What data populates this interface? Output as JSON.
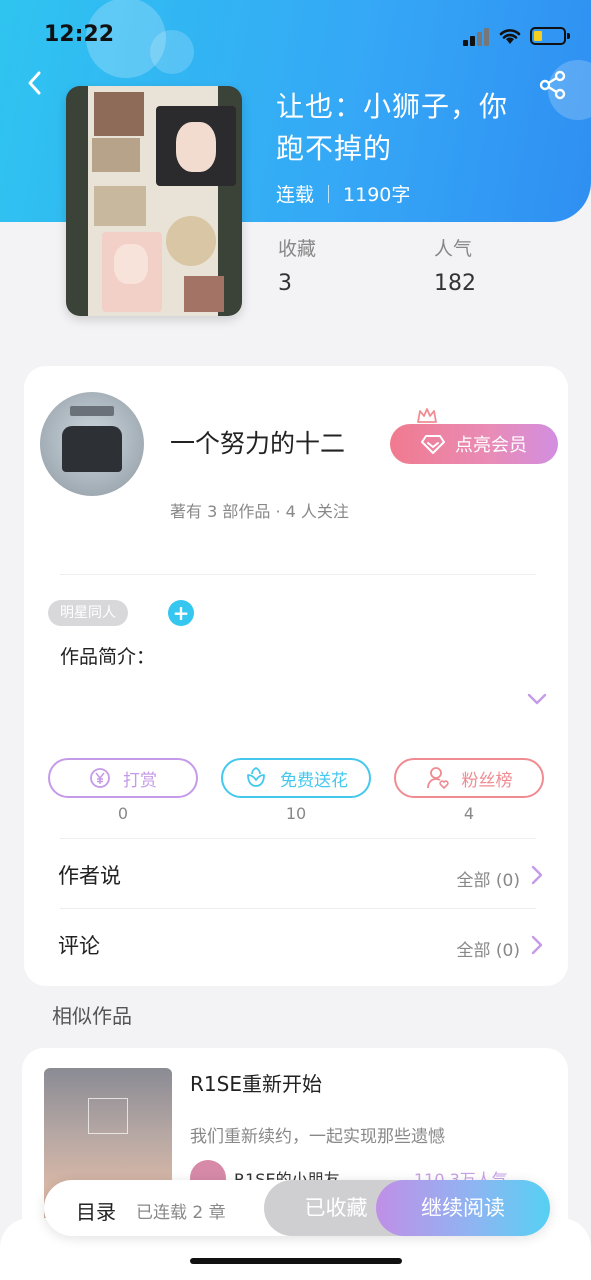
{
  "status_bar": {
    "time": "12:22"
  },
  "book": {
    "title": "让也：小狮子，你跑不掉的",
    "status": "连载",
    "word_count": "1190字",
    "stats": [
      {
        "label": "收藏",
        "value": "3"
      },
      {
        "label": "人气",
        "value": "182"
      }
    ]
  },
  "author": {
    "name": "一个努力的十二",
    "summary": "著有 3 部作品 · 4 人关注",
    "vip_button": "点亮会员"
  },
  "work": {
    "tag": "明星同人",
    "add_tag": "+",
    "intro_label": "作品简介："
  },
  "actions": [
    {
      "label": "打赏",
      "count": "0",
      "color": "#c59ae8",
      "icon": "yen-icon"
    },
    {
      "label": "免费送花",
      "count": "10",
      "color": "#45c8ee",
      "icon": "flower-icon"
    },
    {
      "label": "粉丝榜",
      "count": "4",
      "color": "#f08b92",
      "icon": "fan-icon"
    }
  ],
  "rows": [
    {
      "label": "作者说",
      "value": "全部 (0)"
    },
    {
      "label": "评论",
      "value": "全部 (0)"
    }
  ],
  "similar": {
    "section_title": "相似作品",
    "items": [
      {
        "title": "R1SE重新开始",
        "desc": "我们重新续约，一起实现那些遗憾",
        "author": "R1SE的小朋友",
        "popularity": "110.3万人气"
      }
    ]
  },
  "bottom_bar": {
    "toc": "目录",
    "toc_sub": "已连载 2 章",
    "collected": "已收藏",
    "continue": "继续阅读"
  },
  "colors": {
    "header_start": "#2fc4f0",
    "header_end": "#2f8ff2",
    "accent_purple": "#c59ae8",
    "accent_blue": "#45c8ee",
    "accent_red": "#f08b92"
  }
}
